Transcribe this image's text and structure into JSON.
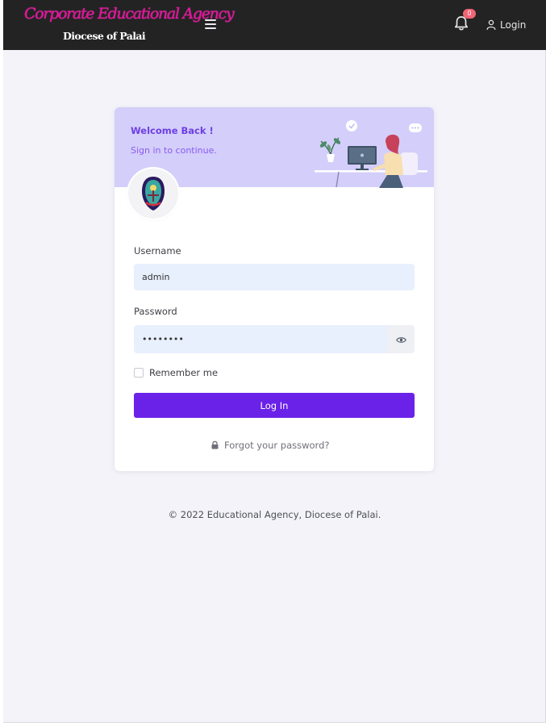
{
  "header": {
    "brand_title": "Corporate Educational Agency",
    "brand_subtitle": "Diocese of Palai",
    "notification_count": "0",
    "login_label": "Login"
  },
  "login_card": {
    "welcome": "Welcome Back !",
    "subtitle": "Sign in to continue.",
    "username_label": "Username",
    "username_value": "admin",
    "password_label": "Password",
    "password_value": "••••••••",
    "remember_label": "Remember me",
    "login_button": "Log In",
    "forgot_link": "Forgot your password?"
  },
  "footer": {
    "copyright": "© 2022 Educational Agency, Diocese of Palai."
  },
  "icons": {
    "menu": "hamburger-icon",
    "notifications": "bell-icon",
    "login": "user-icon",
    "show_password": "eye-icon",
    "forgot": "lock-icon"
  },
  "colors": {
    "topbar": "#232323",
    "brand_accent": "#e8119e",
    "primary": "#6b22e8",
    "card_header": "#d4cefa",
    "input_bg": "#e8effd",
    "badge": "#f06575"
  }
}
